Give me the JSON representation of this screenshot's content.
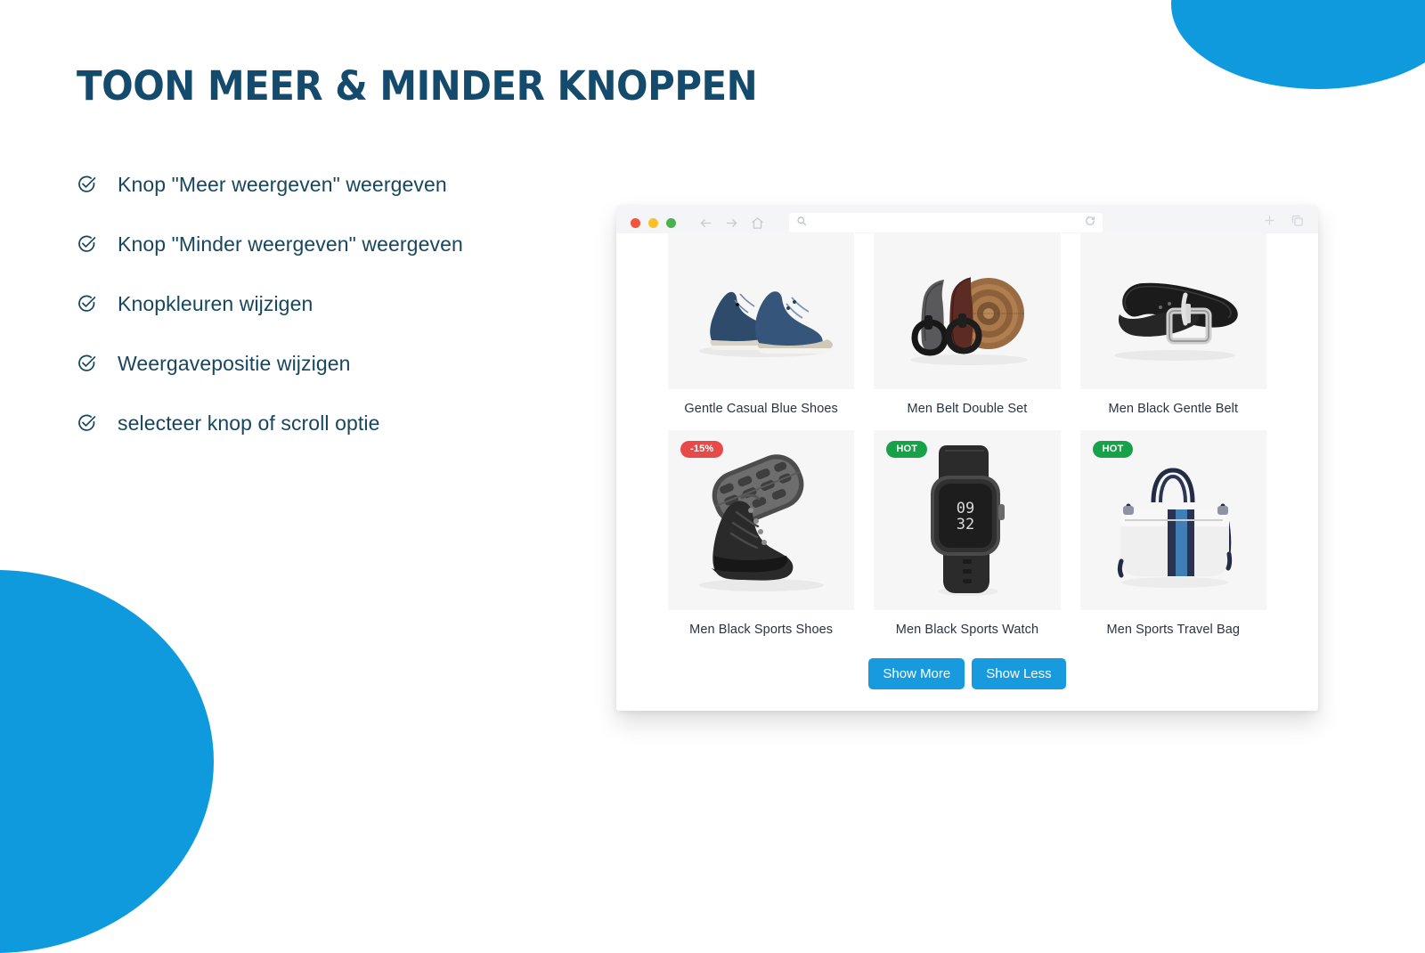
{
  "slide": {
    "title": "TOON MEER & MINDER KNOPPEN",
    "title_color": "#144A6C",
    "accent_color": "#109ADE",
    "background_color": "#FFFFFF"
  },
  "bullets": [
    {
      "icon": "check-circle-icon",
      "label": "Knop \"Meer weergeven\" weergeven"
    },
    {
      "icon": "check-circle-icon",
      "label": "Knop \"Minder weergeven\" weergeven"
    },
    {
      "icon": "check-circle-icon",
      "label": "Knopkleuren wijzigen"
    },
    {
      "icon": "check-circle-icon",
      "label": "Weergavepositie wijzigen"
    },
    {
      "icon": "check-circle-icon",
      "label": "selecteer knop of scroll optie"
    }
  ],
  "browser": {
    "traffic_lights": [
      {
        "name": "close",
        "color": "#F1543F"
      },
      {
        "name": "minimize",
        "color": "#FAC02C"
      },
      {
        "name": "maximize",
        "color": "#4CB050"
      }
    ],
    "nav_icons": [
      "back-arrow-icon",
      "forward-arrow-icon",
      "home-icon"
    ],
    "address_bar": {
      "icon": "search-icon",
      "value": "",
      "placeholder": "",
      "reload_icon": "reload-icon"
    },
    "right_icons": [
      "plus-icon",
      "duplicate-tabs-icon"
    ]
  },
  "store": {
    "products": [
      {
        "name": "Gentle Casual Blue Shoes",
        "image": "blue-dress-shoes",
        "badge": null,
        "badge_type": null
      },
      {
        "name": "Men Belt Double Set",
        "image": "brown-black-belts",
        "badge": null,
        "badge_type": null
      },
      {
        "name": "Men Black Gentle Belt",
        "image": "black-leather-belt",
        "badge": null,
        "badge_type": null
      },
      {
        "name": "Men Black Sports Shoes",
        "image": "black-hiking-boots",
        "badge": "-15%",
        "badge_type": "sale"
      },
      {
        "name": "Men Black Sports Watch",
        "image": "black-smart-watch",
        "badge": "HOT",
        "badge_type": "hot"
      },
      {
        "name": "Men Sports Travel Bag",
        "image": "white-blue-duffel-bag",
        "badge": "HOT",
        "badge_type": "hot"
      }
    ],
    "watch_display_time": "09:32",
    "buttons": {
      "show_more": "Show More",
      "show_less": "Show Less",
      "button_color": "#189BDE"
    },
    "badge_colors": {
      "sale": "#E84A4A",
      "hot": "#17A24A"
    }
  }
}
